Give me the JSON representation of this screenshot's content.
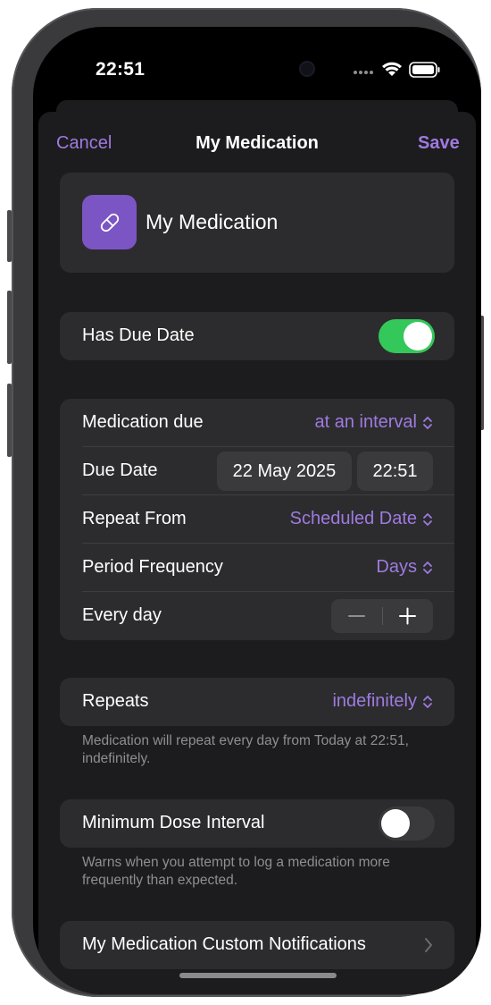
{
  "status_bar": {
    "time": "22:51"
  },
  "nav": {
    "cancel": "Cancel",
    "title": "My Medication",
    "save": "Save"
  },
  "medication": {
    "name": "My Medication",
    "icon": "pill-icon"
  },
  "has_due_date": {
    "label": "Has Due Date",
    "on": true
  },
  "schedule": {
    "medication_due_label": "Medication due",
    "medication_due_value": "at an interval",
    "due_date_label": "Due Date",
    "due_date": "22 May 2025",
    "due_time": "22:51",
    "repeat_from_label": "Repeat From",
    "repeat_from_value": "Scheduled Date",
    "period_frequency_label": "Period Frequency",
    "period_frequency_value": "Days",
    "every_label": "Every day"
  },
  "repeats": {
    "label": "Repeats",
    "value": "indefinitely",
    "note": "Medication will repeat every day from Today at 22:51, indefinitely."
  },
  "min_dose_interval": {
    "label": "Minimum Dose Interval",
    "on": false,
    "note": "Warns when you attempt to log a medication more frequently than expected."
  },
  "custom_notifications": {
    "label": "My Medication Custom Notifications"
  },
  "colors": {
    "accent": "#9f7ae0",
    "icon_bg": "#7c55c4",
    "toggle_on": "#34c759",
    "card_bg": "#2c2c2e",
    "sheet_bg": "#1c1c1e"
  }
}
